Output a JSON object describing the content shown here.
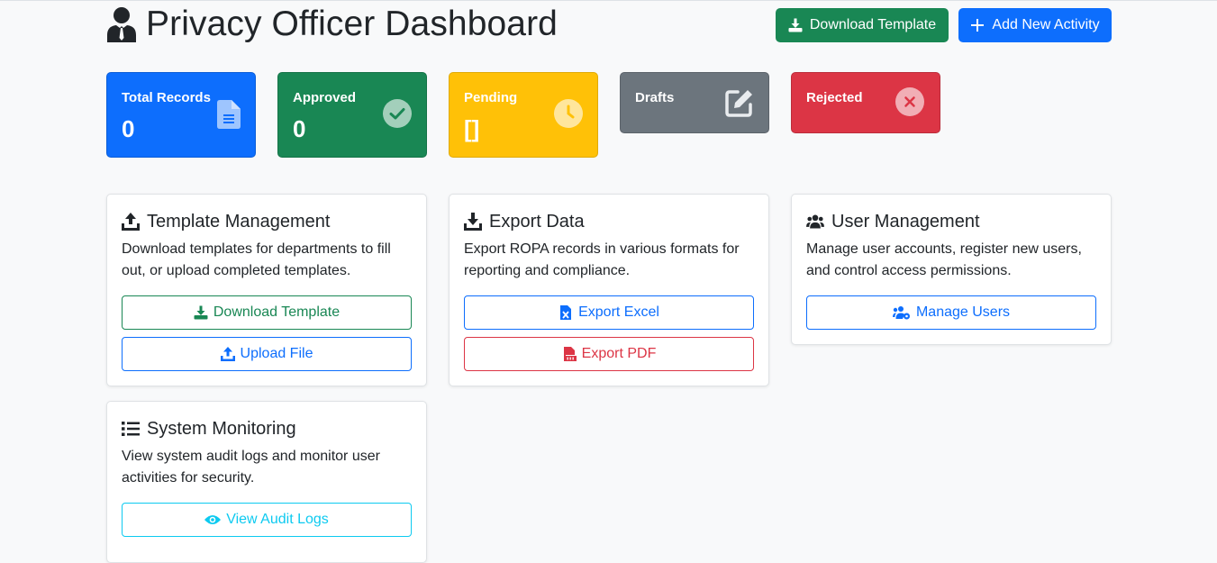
{
  "header": {
    "title": "Privacy Officer Dashboard",
    "download_template_label": "Download Template",
    "add_activity_label": "Add New Activity"
  },
  "stats": {
    "total": {
      "label": "Total Records",
      "value": "0",
      "icon": "file-icon"
    },
    "approved": {
      "label": "Approved",
      "value": "0",
      "icon": "check-circle-icon"
    },
    "pending": {
      "label": "Pending",
      "value": "[]",
      "icon": "clock-icon"
    },
    "drafts": {
      "label": "Drafts",
      "icon": "edit-icon"
    },
    "rejected": {
      "label": "Rejected",
      "icon": "x-circle-icon"
    }
  },
  "cards": {
    "template": {
      "title": "Template Management",
      "text": "Download templates for departments to fill out, or upload completed templates.",
      "button1": "Download Template",
      "button2": "Upload File"
    },
    "export": {
      "title": "Export Data",
      "text": "Export ROPA records in various formats for reporting and compliance.",
      "button1": "Export Excel",
      "button2": "Export PDF"
    },
    "users": {
      "title": "User Management",
      "text": "Manage user accounts, register new users, and control access permissions.",
      "button1": "Manage Users"
    },
    "monitoring": {
      "title": "System Monitoring",
      "text": "View system audit logs and monitor user activities for security.",
      "button1": "View Audit Logs"
    }
  },
  "colors": {
    "primary": "#0d6efd",
    "success": "#198754",
    "warning": "#ffc107",
    "secondary": "#6c757d",
    "danger": "#dc3545",
    "info": "#0dcaf0"
  }
}
